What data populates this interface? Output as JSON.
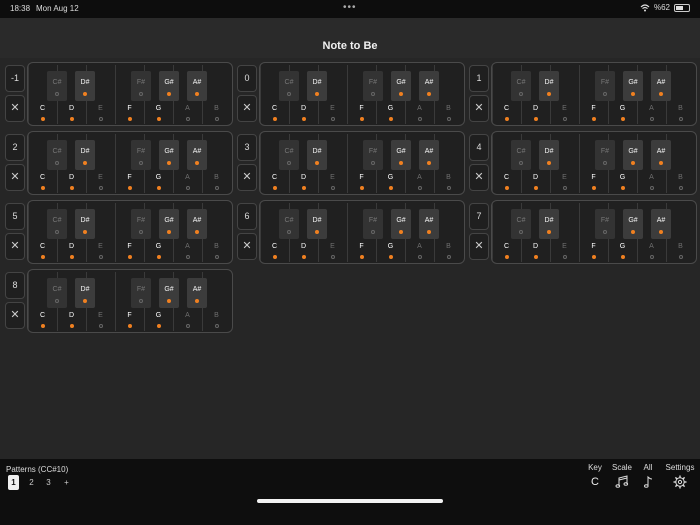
{
  "status": {
    "time": "18:38",
    "date": "Mon Aug 12",
    "battery": "%62",
    "battery_level": 0.62
  },
  "app": {
    "title": "Note to Be"
  },
  "keyboard": {
    "white_keys": [
      "C",
      "D",
      "E",
      "F",
      "G",
      "A",
      "B"
    ],
    "black_keys": [
      "C#",
      "D#",
      "F#",
      "G#",
      "A#"
    ],
    "clear_symbol": "✕"
  },
  "patterns": [
    {
      "label": "-1",
      "active": {
        "C": true,
        "D": true,
        "E": false,
        "F": true,
        "G": true,
        "A": false,
        "B": false,
        "C#": false,
        "D#": true,
        "F#": false,
        "G#": true,
        "A#": true
      }
    },
    {
      "label": "0",
      "active": {
        "C": true,
        "D": true,
        "E": false,
        "F": true,
        "G": true,
        "A": false,
        "B": false,
        "C#": false,
        "D#": true,
        "F#": false,
        "G#": true,
        "A#": true
      }
    },
    {
      "label": "1",
      "active": {
        "C": true,
        "D": true,
        "E": false,
        "F": true,
        "G": true,
        "A": false,
        "B": false,
        "C#": false,
        "D#": true,
        "F#": false,
        "G#": true,
        "A#": true
      }
    },
    {
      "label": "2",
      "active": {
        "C": true,
        "D": true,
        "E": false,
        "F": true,
        "G": true,
        "A": false,
        "B": false,
        "C#": false,
        "D#": true,
        "F#": false,
        "G#": true,
        "A#": true
      }
    },
    {
      "label": "3",
      "active": {
        "C": true,
        "D": true,
        "E": false,
        "F": true,
        "G": true,
        "A": false,
        "B": false,
        "C#": false,
        "D#": true,
        "F#": false,
        "G#": true,
        "A#": true
      }
    },
    {
      "label": "4",
      "active": {
        "C": true,
        "D": true,
        "E": false,
        "F": true,
        "G": true,
        "A": false,
        "B": false,
        "C#": false,
        "D#": true,
        "F#": false,
        "G#": true,
        "A#": true
      }
    },
    {
      "label": "5",
      "active": {
        "C": true,
        "D": true,
        "E": false,
        "F": true,
        "G": true,
        "A": false,
        "B": false,
        "C#": false,
        "D#": true,
        "F#": false,
        "G#": true,
        "A#": true
      }
    },
    {
      "label": "6",
      "active": {
        "C": true,
        "D": true,
        "E": false,
        "F": true,
        "G": true,
        "A": false,
        "B": false,
        "C#": false,
        "D#": true,
        "F#": false,
        "G#": true,
        "A#": true
      }
    },
    {
      "label": "7",
      "active": {
        "C": true,
        "D": true,
        "E": false,
        "F": true,
        "G": true,
        "A": false,
        "B": false,
        "C#": false,
        "D#": true,
        "F#": false,
        "G#": true,
        "A#": true
      }
    },
    {
      "label": "8",
      "active": {
        "C": true,
        "D": true,
        "E": false,
        "F": true,
        "G": true,
        "A": false,
        "B": false,
        "C#": false,
        "D#": true,
        "F#": false,
        "G#": true,
        "A#": true
      }
    }
  ],
  "bottom": {
    "patterns_label": "Patterns (CC#10)",
    "tabs": [
      "1",
      "2",
      "3",
      "+"
    ],
    "selected_tab": "1",
    "key_label": "Key",
    "key_value": "C",
    "scale_label": "Scale",
    "scale_icon": "music-notes-icon",
    "all_label": "All",
    "all_icon": "music-note-icon",
    "settings_label": "Settings",
    "settings_icon": "gear-icon"
  },
  "colors": {
    "accent": "#f08020",
    "background": "#262626",
    "bar": "#0e0e0e"
  }
}
